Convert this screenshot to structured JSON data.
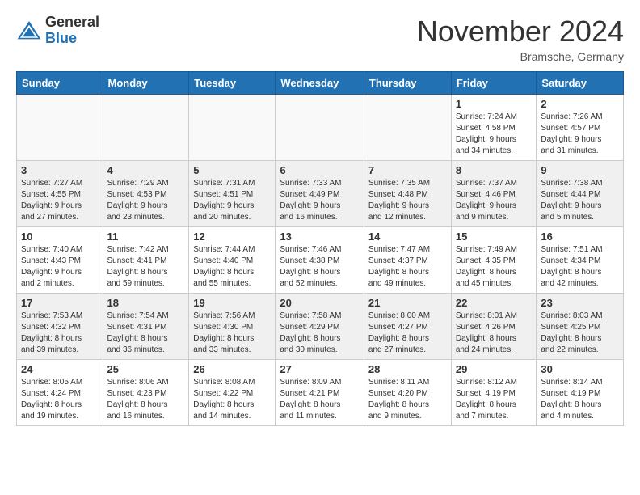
{
  "header": {
    "logo": {
      "general": "General",
      "blue": "Blue"
    },
    "title": "November 2024",
    "location": "Bramsche, Germany"
  },
  "weekdays": [
    "Sunday",
    "Monday",
    "Tuesday",
    "Wednesday",
    "Thursday",
    "Friday",
    "Saturday"
  ],
  "weeks": [
    [
      {
        "day": "",
        "info": ""
      },
      {
        "day": "",
        "info": ""
      },
      {
        "day": "",
        "info": ""
      },
      {
        "day": "",
        "info": ""
      },
      {
        "day": "",
        "info": ""
      },
      {
        "day": "1",
        "info": "Sunrise: 7:24 AM\nSunset: 4:58 PM\nDaylight: 9 hours\nand 34 minutes."
      },
      {
        "day": "2",
        "info": "Sunrise: 7:26 AM\nSunset: 4:57 PM\nDaylight: 9 hours\nand 31 minutes."
      }
    ],
    [
      {
        "day": "3",
        "info": "Sunrise: 7:27 AM\nSunset: 4:55 PM\nDaylight: 9 hours\nand 27 minutes."
      },
      {
        "day": "4",
        "info": "Sunrise: 7:29 AM\nSunset: 4:53 PM\nDaylight: 9 hours\nand 23 minutes."
      },
      {
        "day": "5",
        "info": "Sunrise: 7:31 AM\nSunset: 4:51 PM\nDaylight: 9 hours\nand 20 minutes."
      },
      {
        "day": "6",
        "info": "Sunrise: 7:33 AM\nSunset: 4:49 PM\nDaylight: 9 hours\nand 16 minutes."
      },
      {
        "day": "7",
        "info": "Sunrise: 7:35 AM\nSunset: 4:48 PM\nDaylight: 9 hours\nand 12 minutes."
      },
      {
        "day": "8",
        "info": "Sunrise: 7:37 AM\nSunset: 4:46 PM\nDaylight: 9 hours\nand 9 minutes."
      },
      {
        "day": "9",
        "info": "Sunrise: 7:38 AM\nSunset: 4:44 PM\nDaylight: 9 hours\nand 5 minutes."
      }
    ],
    [
      {
        "day": "10",
        "info": "Sunrise: 7:40 AM\nSunset: 4:43 PM\nDaylight: 9 hours\nand 2 minutes."
      },
      {
        "day": "11",
        "info": "Sunrise: 7:42 AM\nSunset: 4:41 PM\nDaylight: 8 hours\nand 59 minutes."
      },
      {
        "day": "12",
        "info": "Sunrise: 7:44 AM\nSunset: 4:40 PM\nDaylight: 8 hours\nand 55 minutes."
      },
      {
        "day": "13",
        "info": "Sunrise: 7:46 AM\nSunset: 4:38 PM\nDaylight: 8 hours\nand 52 minutes."
      },
      {
        "day": "14",
        "info": "Sunrise: 7:47 AM\nSunset: 4:37 PM\nDaylight: 8 hours\nand 49 minutes."
      },
      {
        "day": "15",
        "info": "Sunrise: 7:49 AM\nSunset: 4:35 PM\nDaylight: 8 hours\nand 45 minutes."
      },
      {
        "day": "16",
        "info": "Sunrise: 7:51 AM\nSunset: 4:34 PM\nDaylight: 8 hours\nand 42 minutes."
      }
    ],
    [
      {
        "day": "17",
        "info": "Sunrise: 7:53 AM\nSunset: 4:32 PM\nDaylight: 8 hours\nand 39 minutes."
      },
      {
        "day": "18",
        "info": "Sunrise: 7:54 AM\nSunset: 4:31 PM\nDaylight: 8 hours\nand 36 minutes."
      },
      {
        "day": "19",
        "info": "Sunrise: 7:56 AM\nSunset: 4:30 PM\nDaylight: 8 hours\nand 33 minutes."
      },
      {
        "day": "20",
        "info": "Sunrise: 7:58 AM\nSunset: 4:29 PM\nDaylight: 8 hours\nand 30 minutes."
      },
      {
        "day": "21",
        "info": "Sunrise: 8:00 AM\nSunset: 4:27 PM\nDaylight: 8 hours\nand 27 minutes."
      },
      {
        "day": "22",
        "info": "Sunrise: 8:01 AM\nSunset: 4:26 PM\nDaylight: 8 hours\nand 24 minutes."
      },
      {
        "day": "23",
        "info": "Sunrise: 8:03 AM\nSunset: 4:25 PM\nDaylight: 8 hours\nand 22 minutes."
      }
    ],
    [
      {
        "day": "24",
        "info": "Sunrise: 8:05 AM\nSunset: 4:24 PM\nDaylight: 8 hours\nand 19 minutes."
      },
      {
        "day": "25",
        "info": "Sunrise: 8:06 AM\nSunset: 4:23 PM\nDaylight: 8 hours\nand 16 minutes."
      },
      {
        "day": "26",
        "info": "Sunrise: 8:08 AM\nSunset: 4:22 PM\nDaylight: 8 hours\nand 14 minutes."
      },
      {
        "day": "27",
        "info": "Sunrise: 8:09 AM\nSunset: 4:21 PM\nDaylight: 8 hours\nand 11 minutes."
      },
      {
        "day": "28",
        "info": "Sunrise: 8:11 AM\nSunset: 4:20 PM\nDaylight: 8 hours\nand 9 minutes."
      },
      {
        "day": "29",
        "info": "Sunrise: 8:12 AM\nSunset: 4:19 PM\nDaylight: 8 hours\nand 7 minutes."
      },
      {
        "day": "30",
        "info": "Sunrise: 8:14 AM\nSunset: 4:19 PM\nDaylight: 8 hours\nand 4 minutes."
      }
    ]
  ]
}
